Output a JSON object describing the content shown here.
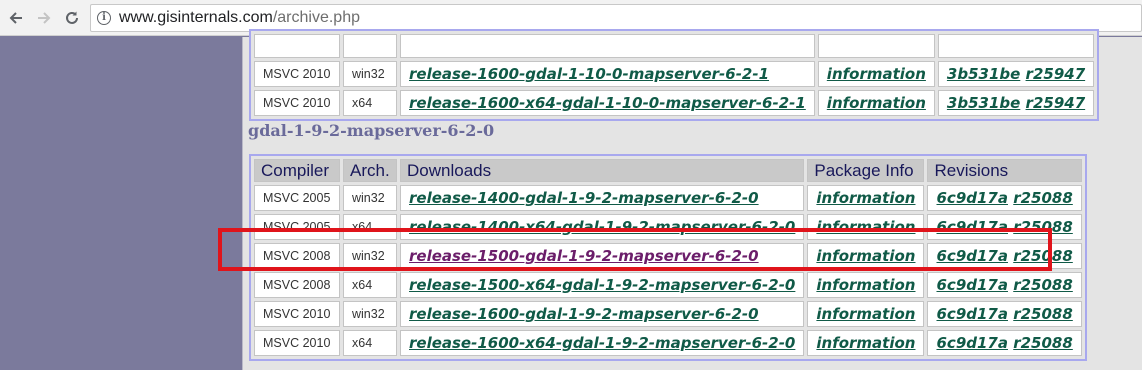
{
  "browser": {
    "url_host": "www.gisinternals.com",
    "url_path": "/archive.php"
  },
  "table1": {
    "rows": [
      {
        "compiler": "MSVC 2010",
        "arch": "win32",
        "download": "release-1600-gdal-1-10-0-mapserver-6-2-1",
        "info": "information",
        "rev_hash": "3b531be",
        "rev_num": "r25947"
      },
      {
        "compiler": "MSVC 2010",
        "arch": "x64",
        "download": "release-1600-x64-gdal-1-10-0-mapserver-6-2-1",
        "info": "information",
        "rev_hash": "3b531be",
        "rev_num": "r25947"
      }
    ]
  },
  "section2": {
    "title": "gdal-1-9-2-mapserver-6-2-0",
    "headers": {
      "compiler": "Compiler",
      "arch": "Arch.",
      "downloads": "Downloads",
      "package_info": "Package Info",
      "revisions": "Revisions"
    },
    "rows": [
      {
        "compiler": "MSVC 2005",
        "arch": "win32",
        "download": "release-1400-gdal-1-9-2-mapserver-6-2-0",
        "info": "information",
        "rev_hash": "6c9d17a",
        "rev_num": "r25088"
      },
      {
        "compiler": "MSVC 2005",
        "arch": "x64",
        "download": "release-1400-x64-gdal-1-9-2-mapserver-6-2-0",
        "info": "information",
        "rev_hash": "6c9d17a",
        "rev_num": "r25088"
      },
      {
        "compiler": "MSVC 2008",
        "arch": "win32",
        "download": "release-1500-gdal-1-9-2-mapserver-6-2-0",
        "info": "information",
        "rev_hash": "6c9d17a",
        "rev_num": "r25088"
      },
      {
        "compiler": "MSVC 2008",
        "arch": "x64",
        "download": "release-1500-x64-gdal-1-9-2-mapserver-6-2-0",
        "info": "information",
        "rev_hash": "6c9d17a",
        "rev_num": "r25088"
      },
      {
        "compiler": "MSVC 2010",
        "arch": "win32",
        "download": "release-1600-gdal-1-9-2-mapserver-6-2-0",
        "info": "information",
        "rev_hash": "6c9d17a",
        "rev_num": "r25088"
      },
      {
        "compiler": "MSVC 2010",
        "arch": "x64",
        "download": "release-1600-x64-gdal-1-9-2-mapserver-6-2-0",
        "info": "information",
        "rev_hash": "6c9d17a",
        "rev_num": "r25088"
      }
    ]
  },
  "colors": {
    "highlight": "#e0141b",
    "link": "#105a47",
    "visited_link": "#6b1d6a"
  }
}
